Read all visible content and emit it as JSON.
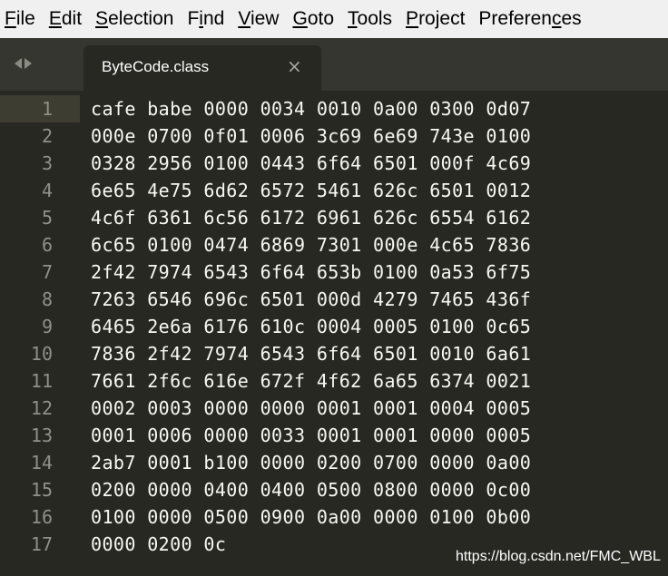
{
  "menu": [
    "File",
    "Edit",
    "Selection",
    "Find",
    "View",
    "Goto",
    "Tools",
    "Project",
    "Preferences"
  ],
  "tab": {
    "title": "ByteCode.class",
    "close": "×"
  },
  "lines": [
    {
      "n": "1",
      "text": "cafe babe 0000 0034 0010 0a00 0300 0d07"
    },
    {
      "n": "2",
      "text": "000e 0700 0f01 0006 3c69 6e69 743e 0100"
    },
    {
      "n": "3",
      "text": "0328 2956 0100 0443 6f64 6501 000f 4c69"
    },
    {
      "n": "4",
      "text": "6e65 4e75 6d62 6572 5461 626c 6501 0012"
    },
    {
      "n": "5",
      "text": "4c6f 6361 6c56 6172 6961 626c 6554 6162"
    },
    {
      "n": "6",
      "text": "6c65 0100 0474 6869 7301 000e 4c65 7836"
    },
    {
      "n": "7",
      "text": "2f42 7974 6543 6f64 653b 0100 0a53 6f75"
    },
    {
      "n": "8",
      "text": "7263 6546 696c 6501 000d 4279 7465 436f"
    },
    {
      "n": "9",
      "text": "6465 2e6a 6176 610c 0004 0005 0100 0c65"
    },
    {
      "n": "10",
      "text": "7836 2f42 7974 6543 6f64 6501 0010 6a61"
    },
    {
      "n": "11",
      "text": "7661 2f6c 616e 672f 4f62 6a65 6374 0021"
    },
    {
      "n": "12",
      "text": "0002 0003 0000 0000 0001 0001 0004 0005"
    },
    {
      "n": "13",
      "text": "0001 0006 0000 0033 0001 0001 0000 0005"
    },
    {
      "n": "14",
      "text": "2ab7 0001 b100 0000 0200 0700 0000 0a00"
    },
    {
      "n": "15",
      "text": "0200 0000 0400 0400 0500 0800 0000 0c00"
    },
    {
      "n": "16",
      "text": "0100 0000 0500 0900 0a00 0000 0100 0b00"
    },
    {
      "n": "17",
      "text": "0000 0200 0c"
    }
  ],
  "watermark": "https://blog.csdn.net/FMC_WBL"
}
